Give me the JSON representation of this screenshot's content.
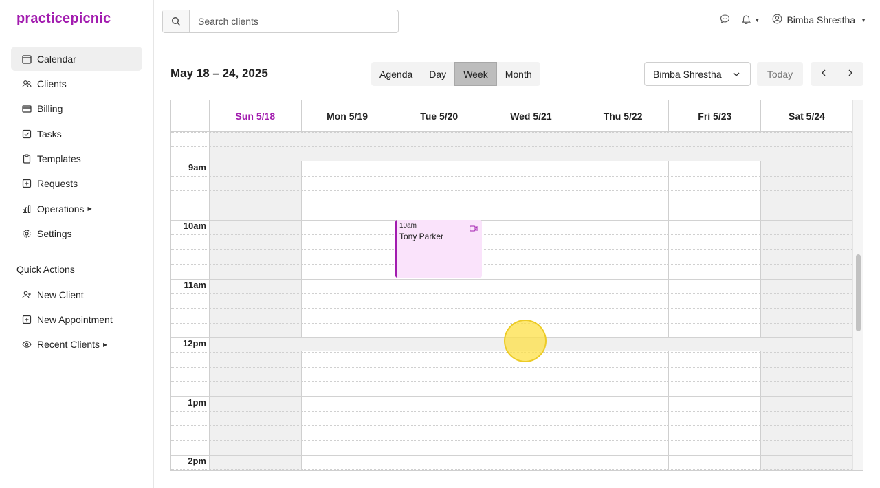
{
  "app": {
    "logo": "practicepicnic"
  },
  "sidebar": {
    "items": [
      {
        "label": "Calendar",
        "icon": "calendar-icon",
        "active": true
      },
      {
        "label": "Clients",
        "icon": "users-icon"
      },
      {
        "label": "Billing",
        "icon": "card-icon"
      },
      {
        "label": "Tasks",
        "icon": "checkbox-icon"
      },
      {
        "label": "Templates",
        "icon": "clipboard-icon"
      },
      {
        "label": "Requests",
        "icon": "plus-square-icon"
      },
      {
        "label": "Operations",
        "icon": "bar-chart-icon",
        "has_submenu": true
      },
      {
        "label": "Settings",
        "icon": "gear-icon"
      }
    ],
    "quick_actions_title": "Quick Actions",
    "quick_actions": [
      {
        "label": "New Client",
        "icon": "user-plus-icon"
      },
      {
        "label": "New Appointment",
        "icon": "plus-square-icon"
      },
      {
        "label": "Recent Clients",
        "icon": "eye-icon",
        "has_submenu": true
      }
    ]
  },
  "topbar": {
    "search_placeholder": "Search clients",
    "user_name": "Bimba Shrestha"
  },
  "toolbar": {
    "range_title": "May 18 – 24, 2025",
    "views": [
      "Agenda",
      "Day",
      "Week",
      "Month"
    ],
    "active_view": "Week",
    "clinician": "Bimba Shrestha",
    "today_label": "Today"
  },
  "calendar": {
    "days": [
      "Sun 5/18",
      "Mon 5/19",
      "Tue 5/20",
      "Wed 5/21",
      "Thu 5/22",
      "Fri 5/23",
      "Sat 5/24"
    ],
    "today_index": 0,
    "hours": [
      "9am",
      "10am",
      "11am",
      "12pm",
      "1pm",
      "2pm"
    ],
    "events": [
      {
        "time": "10am",
        "client": "Tony Parker",
        "day": "Tue 5/20",
        "type": "video"
      }
    ]
  },
  "colors": {
    "brand": "#a21caf",
    "event_bg": "#fae3fb",
    "weekend_bg": "#f0f0f0"
  }
}
